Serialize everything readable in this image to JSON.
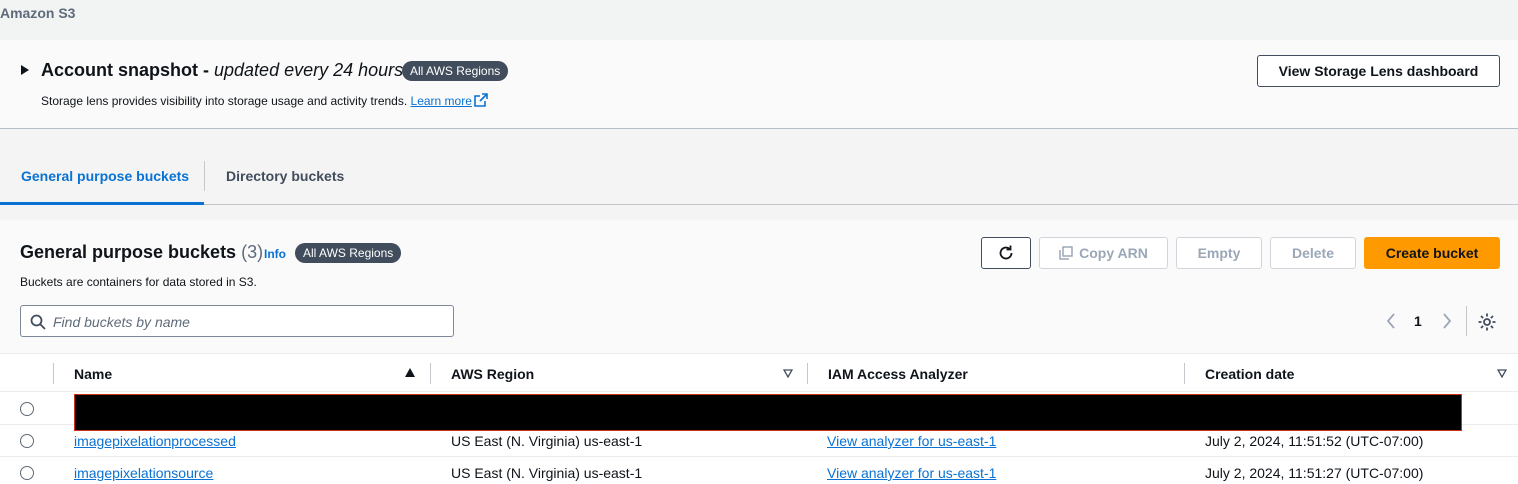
{
  "breadcrumb": {
    "service": "Amazon S3"
  },
  "snapshot": {
    "title": "Account snapshot - ",
    "title_italic": "updated every 24 hours",
    "badge": "All AWS Regions",
    "description": "Storage lens provides visibility into storage usage and activity trends. ",
    "learn_more": "Learn more",
    "lens_button": "View Storage Lens dashboard"
  },
  "tabs": [
    {
      "label": "General purpose buckets",
      "active": true
    },
    {
      "label": "Directory buckets",
      "active": false
    }
  ],
  "panel": {
    "title": "General purpose buckets",
    "count": "(3)",
    "info": "Info",
    "badge": "All AWS Regions",
    "description": "Buckets are containers for data stored in S3.",
    "buttons": {
      "copy_arn": "Copy ARN",
      "empty": "Empty",
      "delete": "Delete",
      "create": "Create bucket"
    },
    "search_placeholder": "Find buckets by name",
    "page": "1"
  },
  "table": {
    "columns": [
      "Name",
      "AWS Region",
      "IAM Access Analyzer",
      "Creation date"
    ],
    "rows": [
      {
        "name": "",
        "region": "",
        "analyzer": "",
        "created": "",
        "redacted": true
      },
      {
        "name": "imagepixelationprocessed",
        "region": "US East (N. Virginia) us-east-1",
        "analyzer": "View analyzer for us-east-1",
        "created": "July 2, 2024, 11:51:52 (UTC-07:00)"
      },
      {
        "name": "imagepixelationsource",
        "region": "US East (N. Virginia) us-east-1",
        "analyzer": "View analyzer for us-east-1",
        "created": "July 2, 2024, 11:51:27 (UTC-07:00)"
      }
    ]
  },
  "colors": {
    "accent": "#0972d3",
    "primary_button": "#ff9900",
    "badge": "#414d5c",
    "redaction": "#000000"
  }
}
